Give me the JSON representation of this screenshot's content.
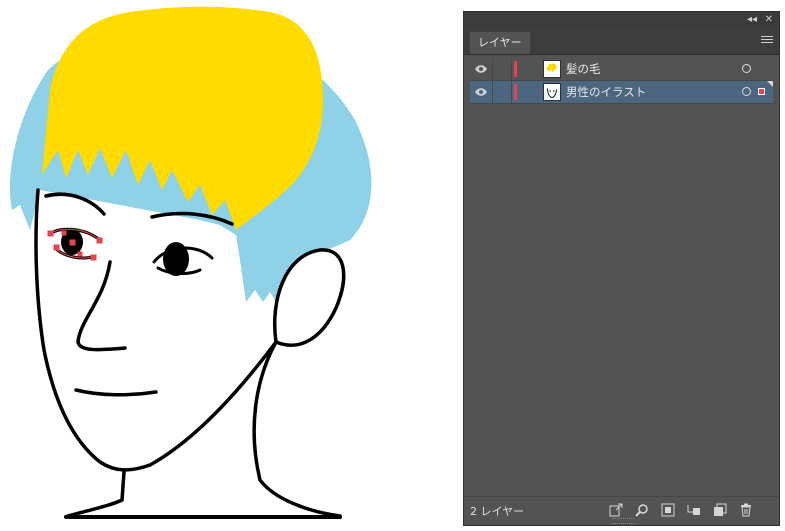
{
  "panel": {
    "tab_label": "レイヤー",
    "layers": [
      {
        "name": "髪の毛",
        "selected": false,
        "color": "#e3454e"
      },
      {
        "name": "男性のイラスト",
        "selected": true,
        "color": "#e3454e"
      }
    ],
    "layer_count": "2 レイヤー",
    "colors": {
      "panel_bg": "#535353",
      "selected_row": "#4c6581",
      "layer_color": "#e3454e"
    }
  },
  "illustration": {
    "colors": {
      "hair_yellow": "#ffdb00",
      "hair_blue": "#8fd1e6",
      "line": "#000000",
      "anchor": "#e3454e"
    }
  }
}
